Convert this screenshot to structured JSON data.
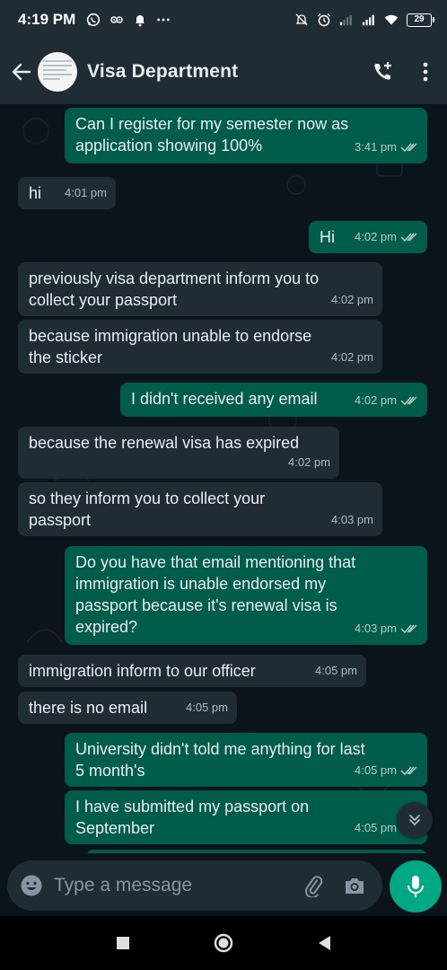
{
  "status_bar": {
    "time": "4:19 PM",
    "left_icons": [
      "whatsapp-icon",
      "owl-icon",
      "notification-bell-icon",
      "more-dots-icon"
    ],
    "right_icons": [
      "mute-icon",
      "alarm-icon",
      "signal-weak-icon",
      "signal-full-icon",
      "wifi-icon"
    ],
    "battery": "29"
  },
  "header": {
    "contact_name": "Visa Department",
    "icons": [
      "back-arrow-icon",
      "add-call-icon",
      "overflow-menu-icon"
    ]
  },
  "messages": [
    {
      "dir": "out",
      "text": "Can I register for my semester now as\napplication showing 100%",
      "time": "3:41 pm",
      "read": true
    },
    {
      "dir": "in",
      "text": "hi",
      "time": "4:01 pm"
    },
    {
      "dir": "out",
      "text": "Hi",
      "time": "4:02 pm",
      "read": true
    },
    {
      "dir": "in",
      "text": "previously visa department inform you to\ncollect your passport",
      "time": "4:02 pm"
    },
    {
      "dir": "in",
      "text": "because immigration unable to endorse\nthe sticker",
      "time": "4:02 pm"
    },
    {
      "dir": "out",
      "text": "I didn't received any email",
      "time": "4:02 pm",
      "read": true
    },
    {
      "dir": "in",
      "text": "because the renewal visa has expired",
      "time": "4:02 pm"
    },
    {
      "dir": "in",
      "text": "so they inform you to collect your\npassport",
      "time": "4:03 pm"
    },
    {
      "dir": "out",
      "text": "Do you have that email mentioning that\nimmigration is unable endorsed my\npassport because it's renewal visa is\nexpired?",
      "time": "4:03 pm",
      "read": true
    },
    {
      "dir": "in",
      "text": "immigration inform to our officer",
      "time": "4:05 pm"
    },
    {
      "dir": "in",
      "text": "there is no email",
      "time": "4:05 pm"
    },
    {
      "dir": "out",
      "text": "University didn't told me anything for last\n5 month's",
      "time": "4:05 pm",
      "read": true
    },
    {
      "dir": "out",
      "text": "I have submitted my passport on\nSeptember",
      "time": "4:05 pm",
      "read": true
    }
  ],
  "composer": {
    "placeholder": "Type a message",
    "icons": [
      "emoji-icon",
      "attach-icon",
      "camera-icon",
      "mic-icon"
    ]
  },
  "nav": {
    "icons": [
      "recents-square-icon",
      "home-circle-icon",
      "back-triangle-icon"
    ]
  },
  "colors": {
    "header_bg": "#1f2c33",
    "chat_bg": "#0b141a",
    "incoming_bubble": "#1f2c33",
    "outgoing_bubble": "#005c4b",
    "accent": "#00a884",
    "read_ticks": "#b4ccc4"
  }
}
